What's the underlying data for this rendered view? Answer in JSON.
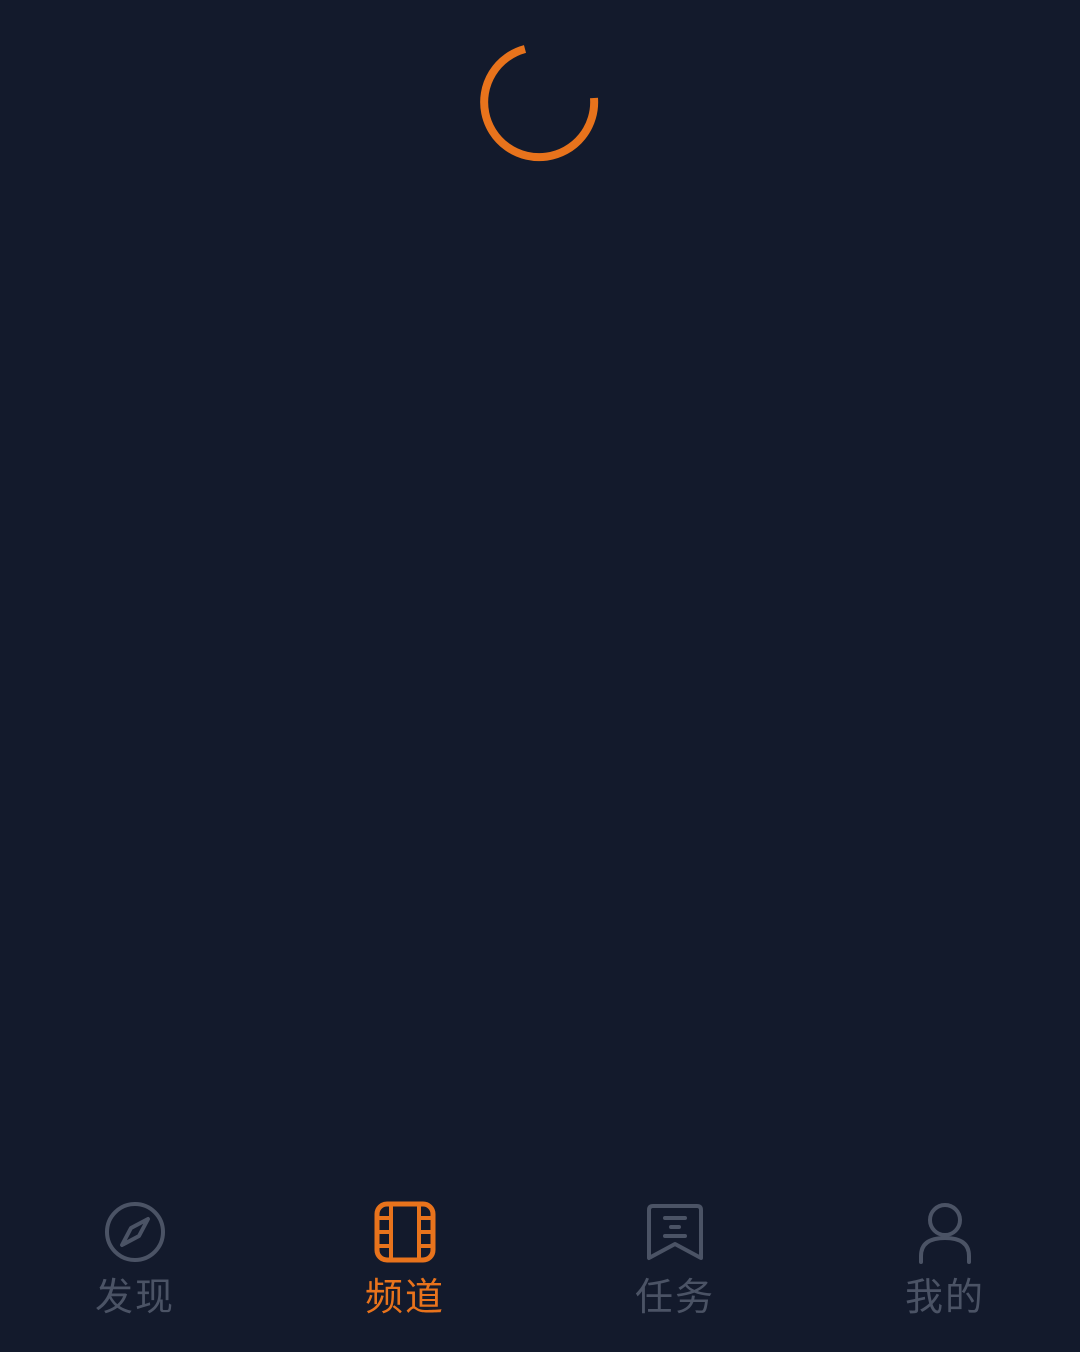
{
  "colors": {
    "background": "#131a2c",
    "accent": "#e8731c",
    "inactive": "#4b5365"
  },
  "loading": {
    "icon": "loading-spinner-icon"
  },
  "tabbar": {
    "active_index": 1,
    "tabs": [
      {
        "label": "发现",
        "icon": "compass-icon"
      },
      {
        "label": "频道",
        "icon": "film-icon"
      },
      {
        "label": "任务",
        "icon": "bookmark-list-icon"
      },
      {
        "label": "我的",
        "icon": "person-icon"
      }
    ]
  }
}
